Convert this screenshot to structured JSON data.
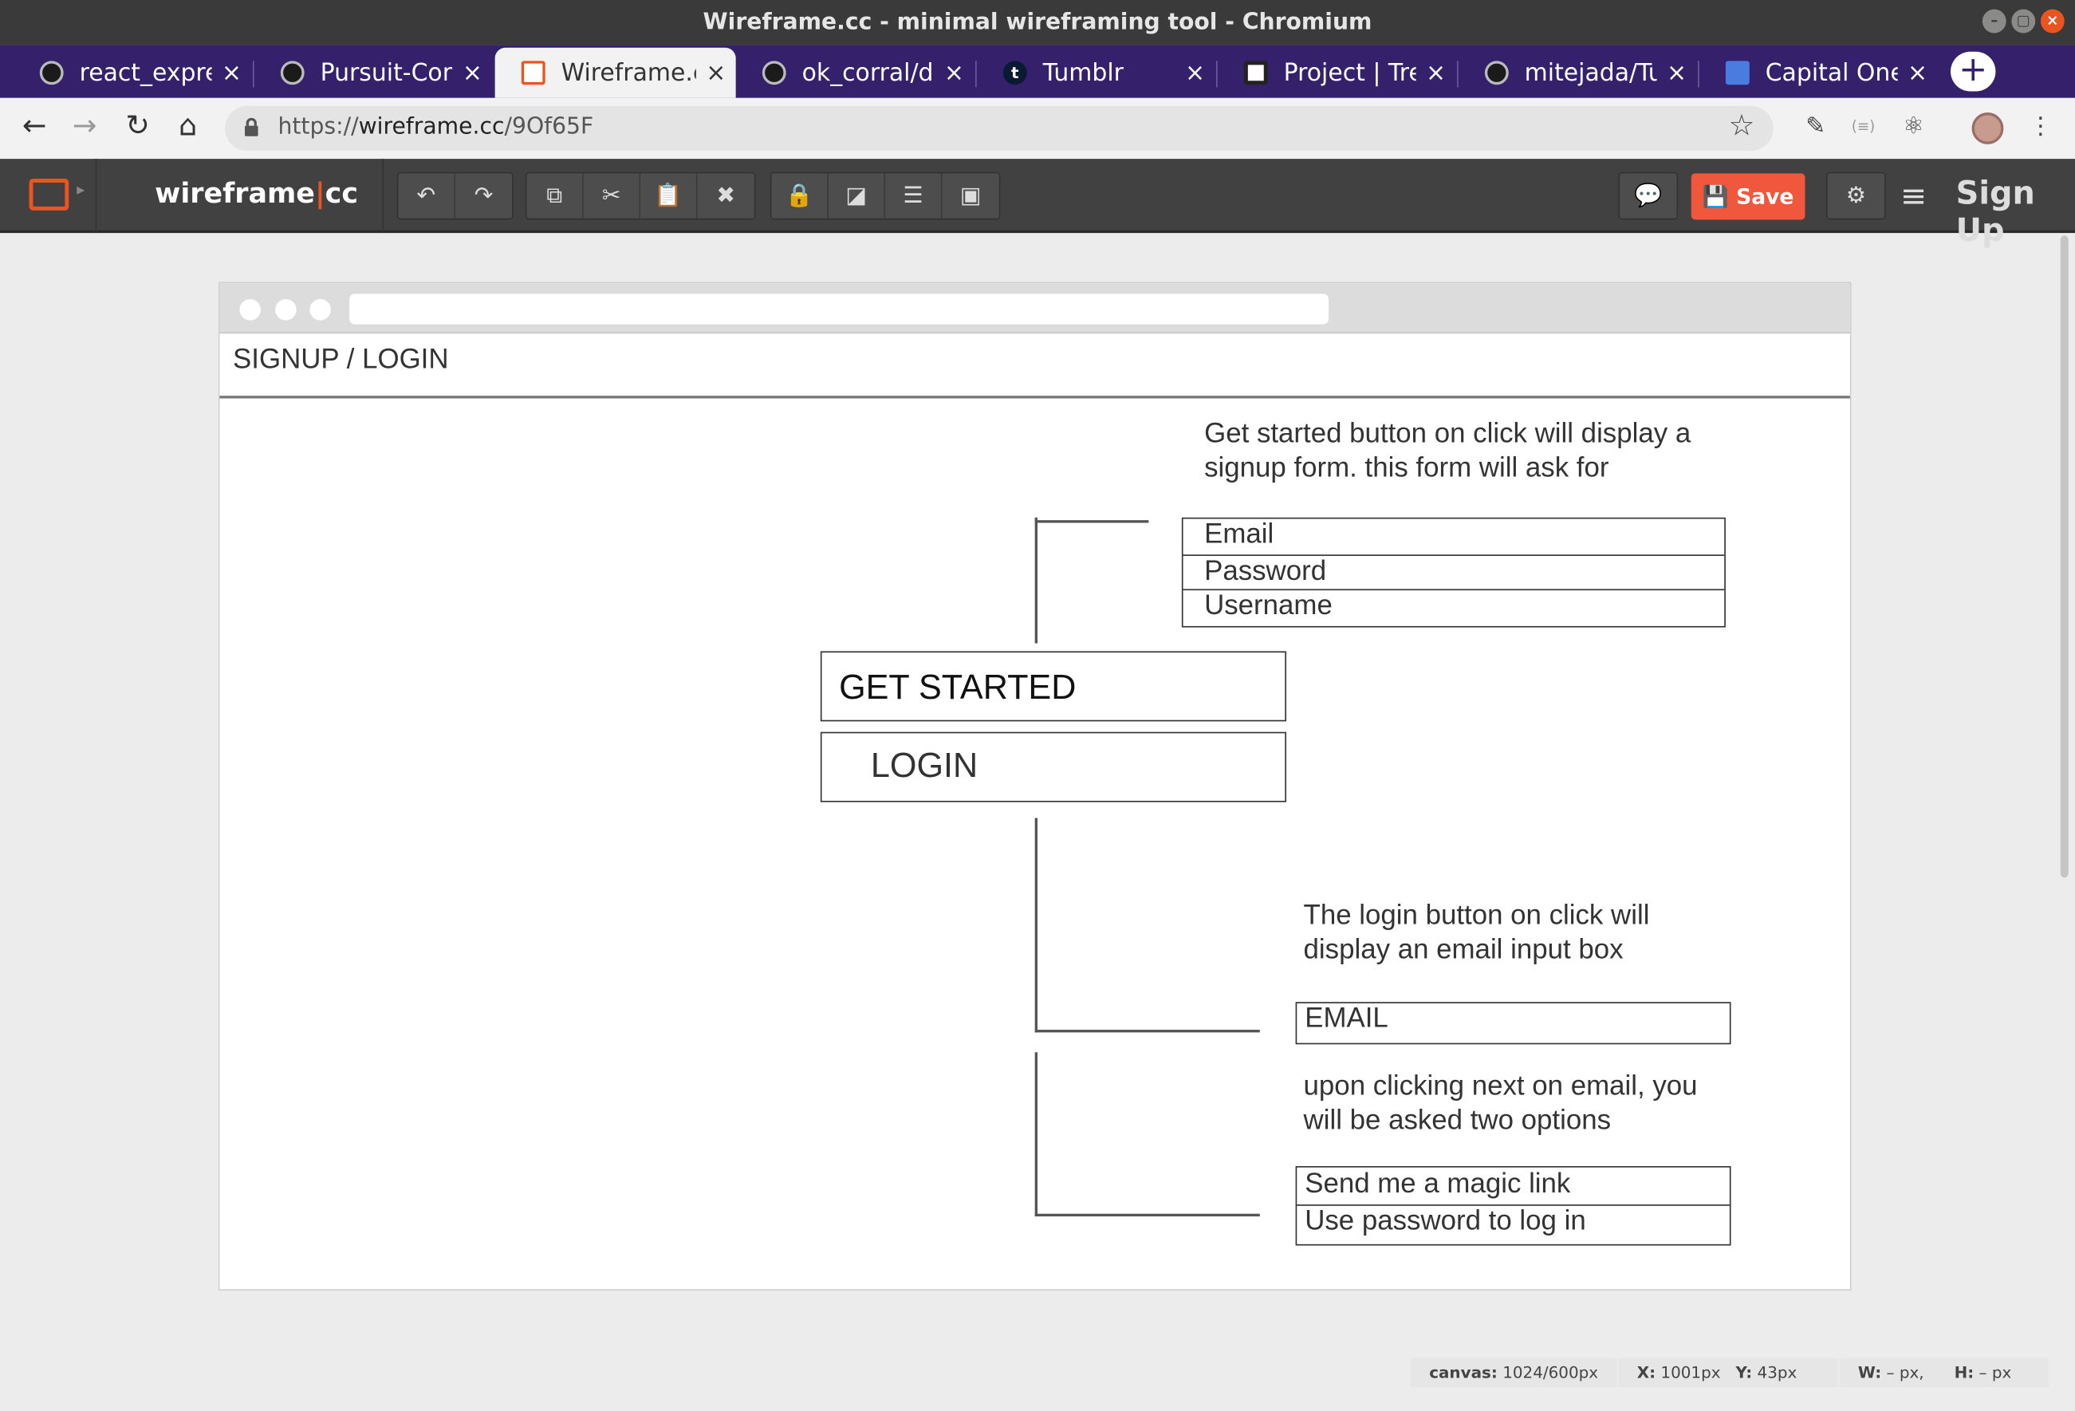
{
  "window": {
    "title": "Wireframe.cc - minimal wireframing tool - Chromium"
  },
  "tabs": [
    {
      "label": "react_express",
      "icon": "github-icon"
    },
    {
      "label": "Pursuit-Core",
      "icon": "github-icon"
    },
    {
      "label": "Wireframe.cc",
      "icon": "wireframe-icon",
      "active": true
    },
    {
      "label": "ok_corral/do",
      "icon": "github-icon"
    },
    {
      "label": "Tumblr",
      "icon": "tumblr-icon"
    },
    {
      "label": "Project | Trello",
      "icon": "trello-icon"
    },
    {
      "label": "mitejada/Tu",
      "icon": "github-icon"
    },
    {
      "label": "Capital One",
      "icon": "docs-icon"
    }
  ],
  "tab_close_glyph": "×",
  "address": {
    "prefix": "https://",
    "host": "wireframe.cc",
    "path": "/9Of65F"
  },
  "app": {
    "logo_left": "wireframe",
    "logo_bar": "|",
    "logo_right": "cc",
    "save_label": "Save",
    "signup_label": "Sign Up"
  },
  "wireframe": {
    "title": "SIGNUP / LOGIN",
    "note_signup": "Get started button on click will display a signup form. this form will ask for",
    "signup_fields": [
      "Email",
      "Password",
      "Username"
    ],
    "get_started_label": "GET STARTED",
    "login_label": "LOGIN",
    "note_login": "The login button on click will display an email input box",
    "email_field": "EMAIL",
    "note_options": "upon clicking next on email, you will be asked two options",
    "login_options": [
      "Send me a magic link",
      "Use password to log in"
    ]
  },
  "statusbar": {
    "canvas_label": "canvas:",
    "canvas_value": "1024/600px",
    "x_label": "X:",
    "x_value": "1001px",
    "y_label": "Y:",
    "y_value": "43px",
    "w_label": "W:",
    "w_value": "– px,",
    "h_label": "H:",
    "h_value": "– px"
  },
  "colors": {
    "accent": "#e95420",
    "save": "#f0573c",
    "tabstrip": "#35206b",
    "toolbar": "#414141"
  }
}
